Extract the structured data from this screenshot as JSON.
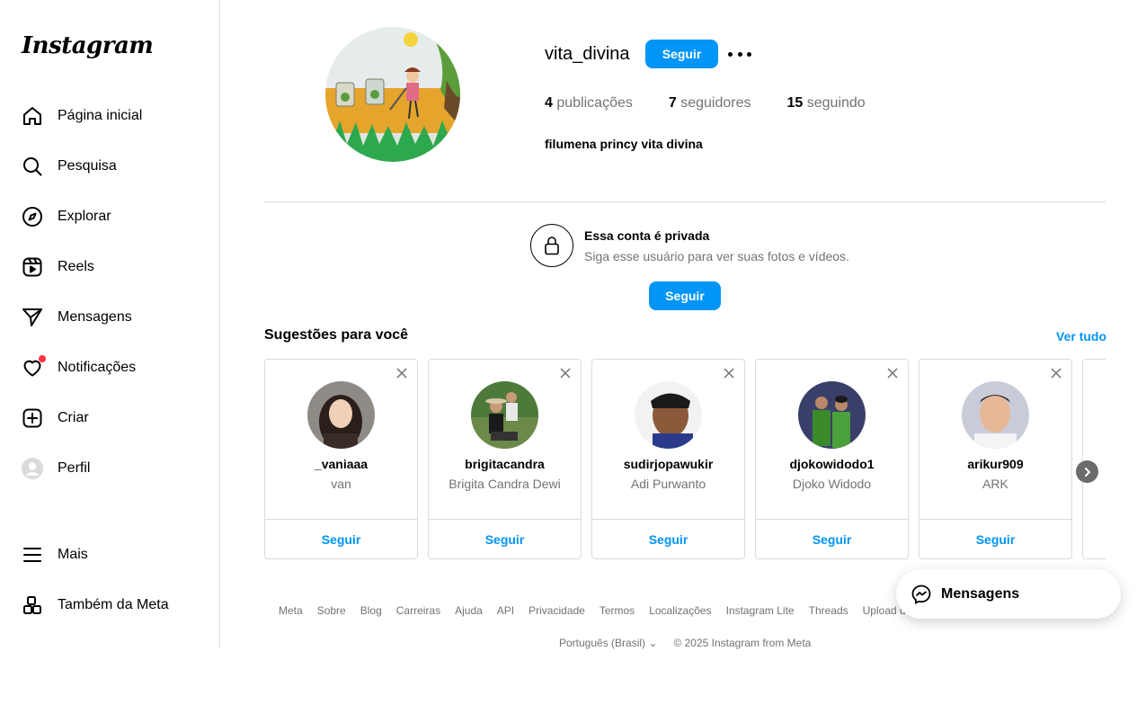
{
  "app": {
    "logo": "Instagram"
  },
  "sidebar": {
    "items": [
      {
        "label": "Página inicial",
        "icon": "home-icon"
      },
      {
        "label": "Pesquisa",
        "icon": "search-icon"
      },
      {
        "label": "Explorar",
        "icon": "compass-icon"
      },
      {
        "label": "Reels",
        "icon": "reels-icon"
      },
      {
        "label": "Mensagens",
        "icon": "send-icon"
      },
      {
        "label": "Notificações",
        "icon": "heart-icon"
      },
      {
        "label": "Criar",
        "icon": "plus-square-icon"
      },
      {
        "label": "Perfil",
        "icon": "avatar-icon"
      },
      {
        "label": "Mais",
        "icon": "menu-icon"
      },
      {
        "label": "Também da Meta",
        "icon": "meta-grid-icon"
      }
    ]
  },
  "profile": {
    "username": "vita_divina",
    "follow_label": "Seguir",
    "posts_count": "4",
    "posts_label": "publicações",
    "followers_count": "7",
    "followers_label": "seguidores",
    "following_count": "15",
    "following_label": "seguindo",
    "full_name": "filumena princy vita divina"
  },
  "private": {
    "title": "Essa conta é privada",
    "subtitle": "Siga esse usuário para ver suas fotos e vídeos.",
    "follow_label": "Seguir"
  },
  "suggestions": {
    "title": "Sugestões para você",
    "see_all": "Ver tudo",
    "follow_label": "Seguir",
    "cards": [
      {
        "username": "_vaniaaa",
        "name": "van"
      },
      {
        "username": "brigitacandra",
        "name": "Brigita Candra Dewi"
      },
      {
        "username": "sudirjopawukir",
        "name": "Adi Purwanto"
      },
      {
        "username": "djokowidodo1",
        "name": "Djoko Widodo"
      },
      {
        "username": "arikur909",
        "name": "ARK"
      }
    ]
  },
  "footer": {
    "links": [
      "Meta",
      "Sobre",
      "Blog",
      "Carreiras",
      "Ajuda",
      "API",
      "Privacidade",
      "Termos",
      "Localizações",
      "Instagram Lite",
      "Threads",
      "Upload de contatos e não usuários"
    ],
    "language": "Português (Brasil)",
    "copyright": "© 2025 Instagram from Meta"
  },
  "messages_float": {
    "label": "Mensagens"
  },
  "colors": {
    "accent": "#0095f6",
    "notification": "#ff3040"
  }
}
